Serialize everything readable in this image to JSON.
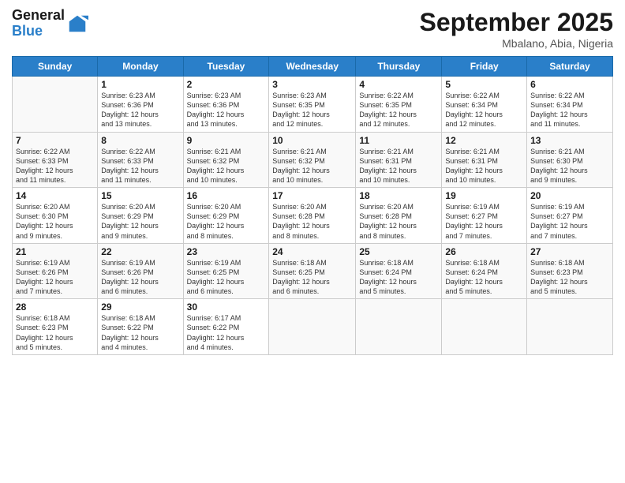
{
  "logo": {
    "line1": "General",
    "line2": "Blue"
  },
  "title": "September 2025",
  "subtitle": "Mbalano, Abia, Nigeria",
  "weekdays": [
    "Sunday",
    "Monday",
    "Tuesday",
    "Wednesday",
    "Thursday",
    "Friday",
    "Saturday"
  ],
  "weeks": [
    [
      {
        "num": "",
        "info": ""
      },
      {
        "num": "1",
        "info": "Sunrise: 6:23 AM\nSunset: 6:36 PM\nDaylight: 12 hours\nand 13 minutes."
      },
      {
        "num": "2",
        "info": "Sunrise: 6:23 AM\nSunset: 6:36 PM\nDaylight: 12 hours\nand 13 minutes."
      },
      {
        "num": "3",
        "info": "Sunrise: 6:23 AM\nSunset: 6:35 PM\nDaylight: 12 hours\nand 12 minutes."
      },
      {
        "num": "4",
        "info": "Sunrise: 6:22 AM\nSunset: 6:35 PM\nDaylight: 12 hours\nand 12 minutes."
      },
      {
        "num": "5",
        "info": "Sunrise: 6:22 AM\nSunset: 6:34 PM\nDaylight: 12 hours\nand 12 minutes."
      },
      {
        "num": "6",
        "info": "Sunrise: 6:22 AM\nSunset: 6:34 PM\nDaylight: 12 hours\nand 11 minutes."
      }
    ],
    [
      {
        "num": "7",
        "info": "Sunrise: 6:22 AM\nSunset: 6:33 PM\nDaylight: 12 hours\nand 11 minutes."
      },
      {
        "num": "8",
        "info": "Sunrise: 6:22 AM\nSunset: 6:33 PM\nDaylight: 12 hours\nand 11 minutes."
      },
      {
        "num": "9",
        "info": "Sunrise: 6:21 AM\nSunset: 6:32 PM\nDaylight: 12 hours\nand 10 minutes."
      },
      {
        "num": "10",
        "info": "Sunrise: 6:21 AM\nSunset: 6:32 PM\nDaylight: 12 hours\nand 10 minutes."
      },
      {
        "num": "11",
        "info": "Sunrise: 6:21 AM\nSunset: 6:31 PM\nDaylight: 12 hours\nand 10 minutes."
      },
      {
        "num": "12",
        "info": "Sunrise: 6:21 AM\nSunset: 6:31 PM\nDaylight: 12 hours\nand 10 minutes."
      },
      {
        "num": "13",
        "info": "Sunrise: 6:21 AM\nSunset: 6:30 PM\nDaylight: 12 hours\nand 9 minutes."
      }
    ],
    [
      {
        "num": "14",
        "info": "Sunrise: 6:20 AM\nSunset: 6:30 PM\nDaylight: 12 hours\nand 9 minutes."
      },
      {
        "num": "15",
        "info": "Sunrise: 6:20 AM\nSunset: 6:29 PM\nDaylight: 12 hours\nand 9 minutes."
      },
      {
        "num": "16",
        "info": "Sunrise: 6:20 AM\nSunset: 6:29 PM\nDaylight: 12 hours\nand 8 minutes."
      },
      {
        "num": "17",
        "info": "Sunrise: 6:20 AM\nSunset: 6:28 PM\nDaylight: 12 hours\nand 8 minutes."
      },
      {
        "num": "18",
        "info": "Sunrise: 6:20 AM\nSunset: 6:28 PM\nDaylight: 12 hours\nand 8 minutes."
      },
      {
        "num": "19",
        "info": "Sunrise: 6:19 AM\nSunset: 6:27 PM\nDaylight: 12 hours\nand 7 minutes."
      },
      {
        "num": "20",
        "info": "Sunrise: 6:19 AM\nSunset: 6:27 PM\nDaylight: 12 hours\nand 7 minutes."
      }
    ],
    [
      {
        "num": "21",
        "info": "Sunrise: 6:19 AM\nSunset: 6:26 PM\nDaylight: 12 hours\nand 7 minutes."
      },
      {
        "num": "22",
        "info": "Sunrise: 6:19 AM\nSunset: 6:26 PM\nDaylight: 12 hours\nand 6 minutes."
      },
      {
        "num": "23",
        "info": "Sunrise: 6:19 AM\nSunset: 6:25 PM\nDaylight: 12 hours\nand 6 minutes."
      },
      {
        "num": "24",
        "info": "Sunrise: 6:18 AM\nSunset: 6:25 PM\nDaylight: 12 hours\nand 6 minutes."
      },
      {
        "num": "25",
        "info": "Sunrise: 6:18 AM\nSunset: 6:24 PM\nDaylight: 12 hours\nand 5 minutes."
      },
      {
        "num": "26",
        "info": "Sunrise: 6:18 AM\nSunset: 6:24 PM\nDaylight: 12 hours\nand 5 minutes."
      },
      {
        "num": "27",
        "info": "Sunrise: 6:18 AM\nSunset: 6:23 PM\nDaylight: 12 hours\nand 5 minutes."
      }
    ],
    [
      {
        "num": "28",
        "info": "Sunrise: 6:18 AM\nSunset: 6:23 PM\nDaylight: 12 hours\nand 5 minutes."
      },
      {
        "num": "29",
        "info": "Sunrise: 6:18 AM\nSunset: 6:22 PM\nDaylight: 12 hours\nand 4 minutes."
      },
      {
        "num": "30",
        "info": "Sunrise: 6:17 AM\nSunset: 6:22 PM\nDaylight: 12 hours\nand 4 minutes."
      },
      {
        "num": "",
        "info": ""
      },
      {
        "num": "",
        "info": ""
      },
      {
        "num": "",
        "info": ""
      },
      {
        "num": "",
        "info": ""
      }
    ]
  ]
}
